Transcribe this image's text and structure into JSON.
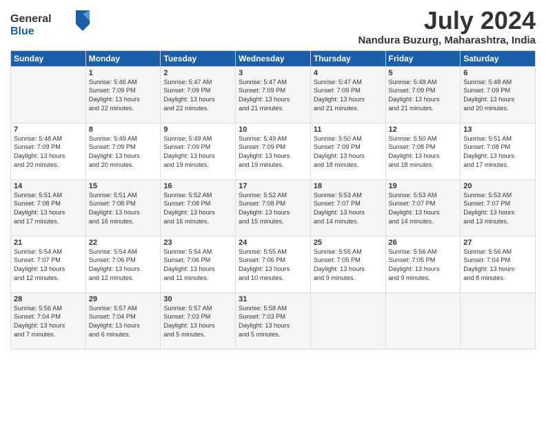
{
  "header": {
    "logo_general": "General",
    "logo_blue": "Blue",
    "month_year": "July 2024",
    "location": "Nandura Buzurg, Maharashtra, India"
  },
  "weekdays": [
    "Sunday",
    "Monday",
    "Tuesday",
    "Wednesday",
    "Thursday",
    "Friday",
    "Saturday"
  ],
  "weeks": [
    [
      {
        "day": "",
        "info": ""
      },
      {
        "day": "1",
        "info": "Sunrise: 5:46 AM\nSunset: 7:09 PM\nDaylight: 13 hours\nand 22 minutes."
      },
      {
        "day": "2",
        "info": "Sunrise: 5:47 AM\nSunset: 7:09 PM\nDaylight: 13 hours\nand 22 minutes."
      },
      {
        "day": "3",
        "info": "Sunrise: 5:47 AM\nSunset: 7:09 PM\nDaylight: 13 hours\nand 21 minutes."
      },
      {
        "day": "4",
        "info": "Sunrise: 5:47 AM\nSunset: 7:09 PM\nDaylight: 13 hours\nand 21 minutes."
      },
      {
        "day": "5",
        "info": "Sunrise: 5:48 AM\nSunset: 7:09 PM\nDaylight: 13 hours\nand 21 minutes."
      },
      {
        "day": "6",
        "info": "Sunrise: 5:48 AM\nSunset: 7:09 PM\nDaylight: 13 hours\nand 20 minutes."
      }
    ],
    [
      {
        "day": "7",
        "info": "Sunrise: 5:48 AM\nSunset: 7:09 PM\nDaylight: 13 hours\nand 20 minutes."
      },
      {
        "day": "8",
        "info": "Sunrise: 5:49 AM\nSunset: 7:09 PM\nDaylight: 13 hours\nand 20 minutes."
      },
      {
        "day": "9",
        "info": "Sunrise: 5:49 AM\nSunset: 7:09 PM\nDaylight: 13 hours\nand 19 minutes."
      },
      {
        "day": "10",
        "info": "Sunrise: 5:49 AM\nSunset: 7:09 PM\nDaylight: 13 hours\nand 19 minutes."
      },
      {
        "day": "11",
        "info": "Sunrise: 5:50 AM\nSunset: 7:09 PM\nDaylight: 13 hours\nand 18 minutes."
      },
      {
        "day": "12",
        "info": "Sunrise: 5:50 AM\nSunset: 7:08 PM\nDaylight: 13 hours\nand 18 minutes."
      },
      {
        "day": "13",
        "info": "Sunrise: 5:51 AM\nSunset: 7:08 PM\nDaylight: 13 hours\nand 17 minutes."
      }
    ],
    [
      {
        "day": "14",
        "info": "Sunrise: 5:51 AM\nSunset: 7:08 PM\nDaylight: 13 hours\nand 17 minutes."
      },
      {
        "day": "15",
        "info": "Sunrise: 5:51 AM\nSunset: 7:08 PM\nDaylight: 13 hours\nand 16 minutes."
      },
      {
        "day": "16",
        "info": "Sunrise: 5:52 AM\nSunset: 7:08 PM\nDaylight: 13 hours\nand 16 minutes."
      },
      {
        "day": "17",
        "info": "Sunrise: 5:52 AM\nSunset: 7:08 PM\nDaylight: 13 hours\nand 15 minutes."
      },
      {
        "day": "18",
        "info": "Sunrise: 5:53 AM\nSunset: 7:07 PM\nDaylight: 13 hours\nand 14 minutes."
      },
      {
        "day": "19",
        "info": "Sunrise: 5:53 AM\nSunset: 7:07 PM\nDaylight: 13 hours\nand 14 minutes."
      },
      {
        "day": "20",
        "info": "Sunrise: 5:53 AM\nSunset: 7:07 PM\nDaylight: 13 hours\nand 13 minutes."
      }
    ],
    [
      {
        "day": "21",
        "info": "Sunrise: 5:54 AM\nSunset: 7:07 PM\nDaylight: 13 hours\nand 12 minutes."
      },
      {
        "day": "22",
        "info": "Sunrise: 5:54 AM\nSunset: 7:06 PM\nDaylight: 13 hours\nand 12 minutes."
      },
      {
        "day": "23",
        "info": "Sunrise: 5:54 AM\nSunset: 7:06 PM\nDaylight: 13 hours\nand 11 minutes."
      },
      {
        "day": "24",
        "info": "Sunrise: 5:55 AM\nSunset: 7:06 PM\nDaylight: 13 hours\nand 10 minutes."
      },
      {
        "day": "25",
        "info": "Sunrise: 5:55 AM\nSunset: 7:05 PM\nDaylight: 13 hours\nand 9 minutes."
      },
      {
        "day": "26",
        "info": "Sunrise: 5:56 AM\nSunset: 7:05 PM\nDaylight: 13 hours\nand 9 minutes."
      },
      {
        "day": "27",
        "info": "Sunrise: 5:56 AM\nSunset: 7:04 PM\nDaylight: 13 hours\nand 8 minutes."
      }
    ],
    [
      {
        "day": "28",
        "info": "Sunrise: 5:56 AM\nSunset: 7:04 PM\nDaylight: 13 hours\nand 7 minutes."
      },
      {
        "day": "29",
        "info": "Sunrise: 5:57 AM\nSunset: 7:04 PM\nDaylight: 13 hours\nand 6 minutes."
      },
      {
        "day": "30",
        "info": "Sunrise: 5:57 AM\nSunset: 7:03 PM\nDaylight: 13 hours\nand 5 minutes."
      },
      {
        "day": "31",
        "info": "Sunrise: 5:58 AM\nSunset: 7:03 PM\nDaylight: 13 hours\nand 5 minutes."
      },
      {
        "day": "",
        "info": ""
      },
      {
        "day": "",
        "info": ""
      },
      {
        "day": "",
        "info": ""
      }
    ]
  ]
}
